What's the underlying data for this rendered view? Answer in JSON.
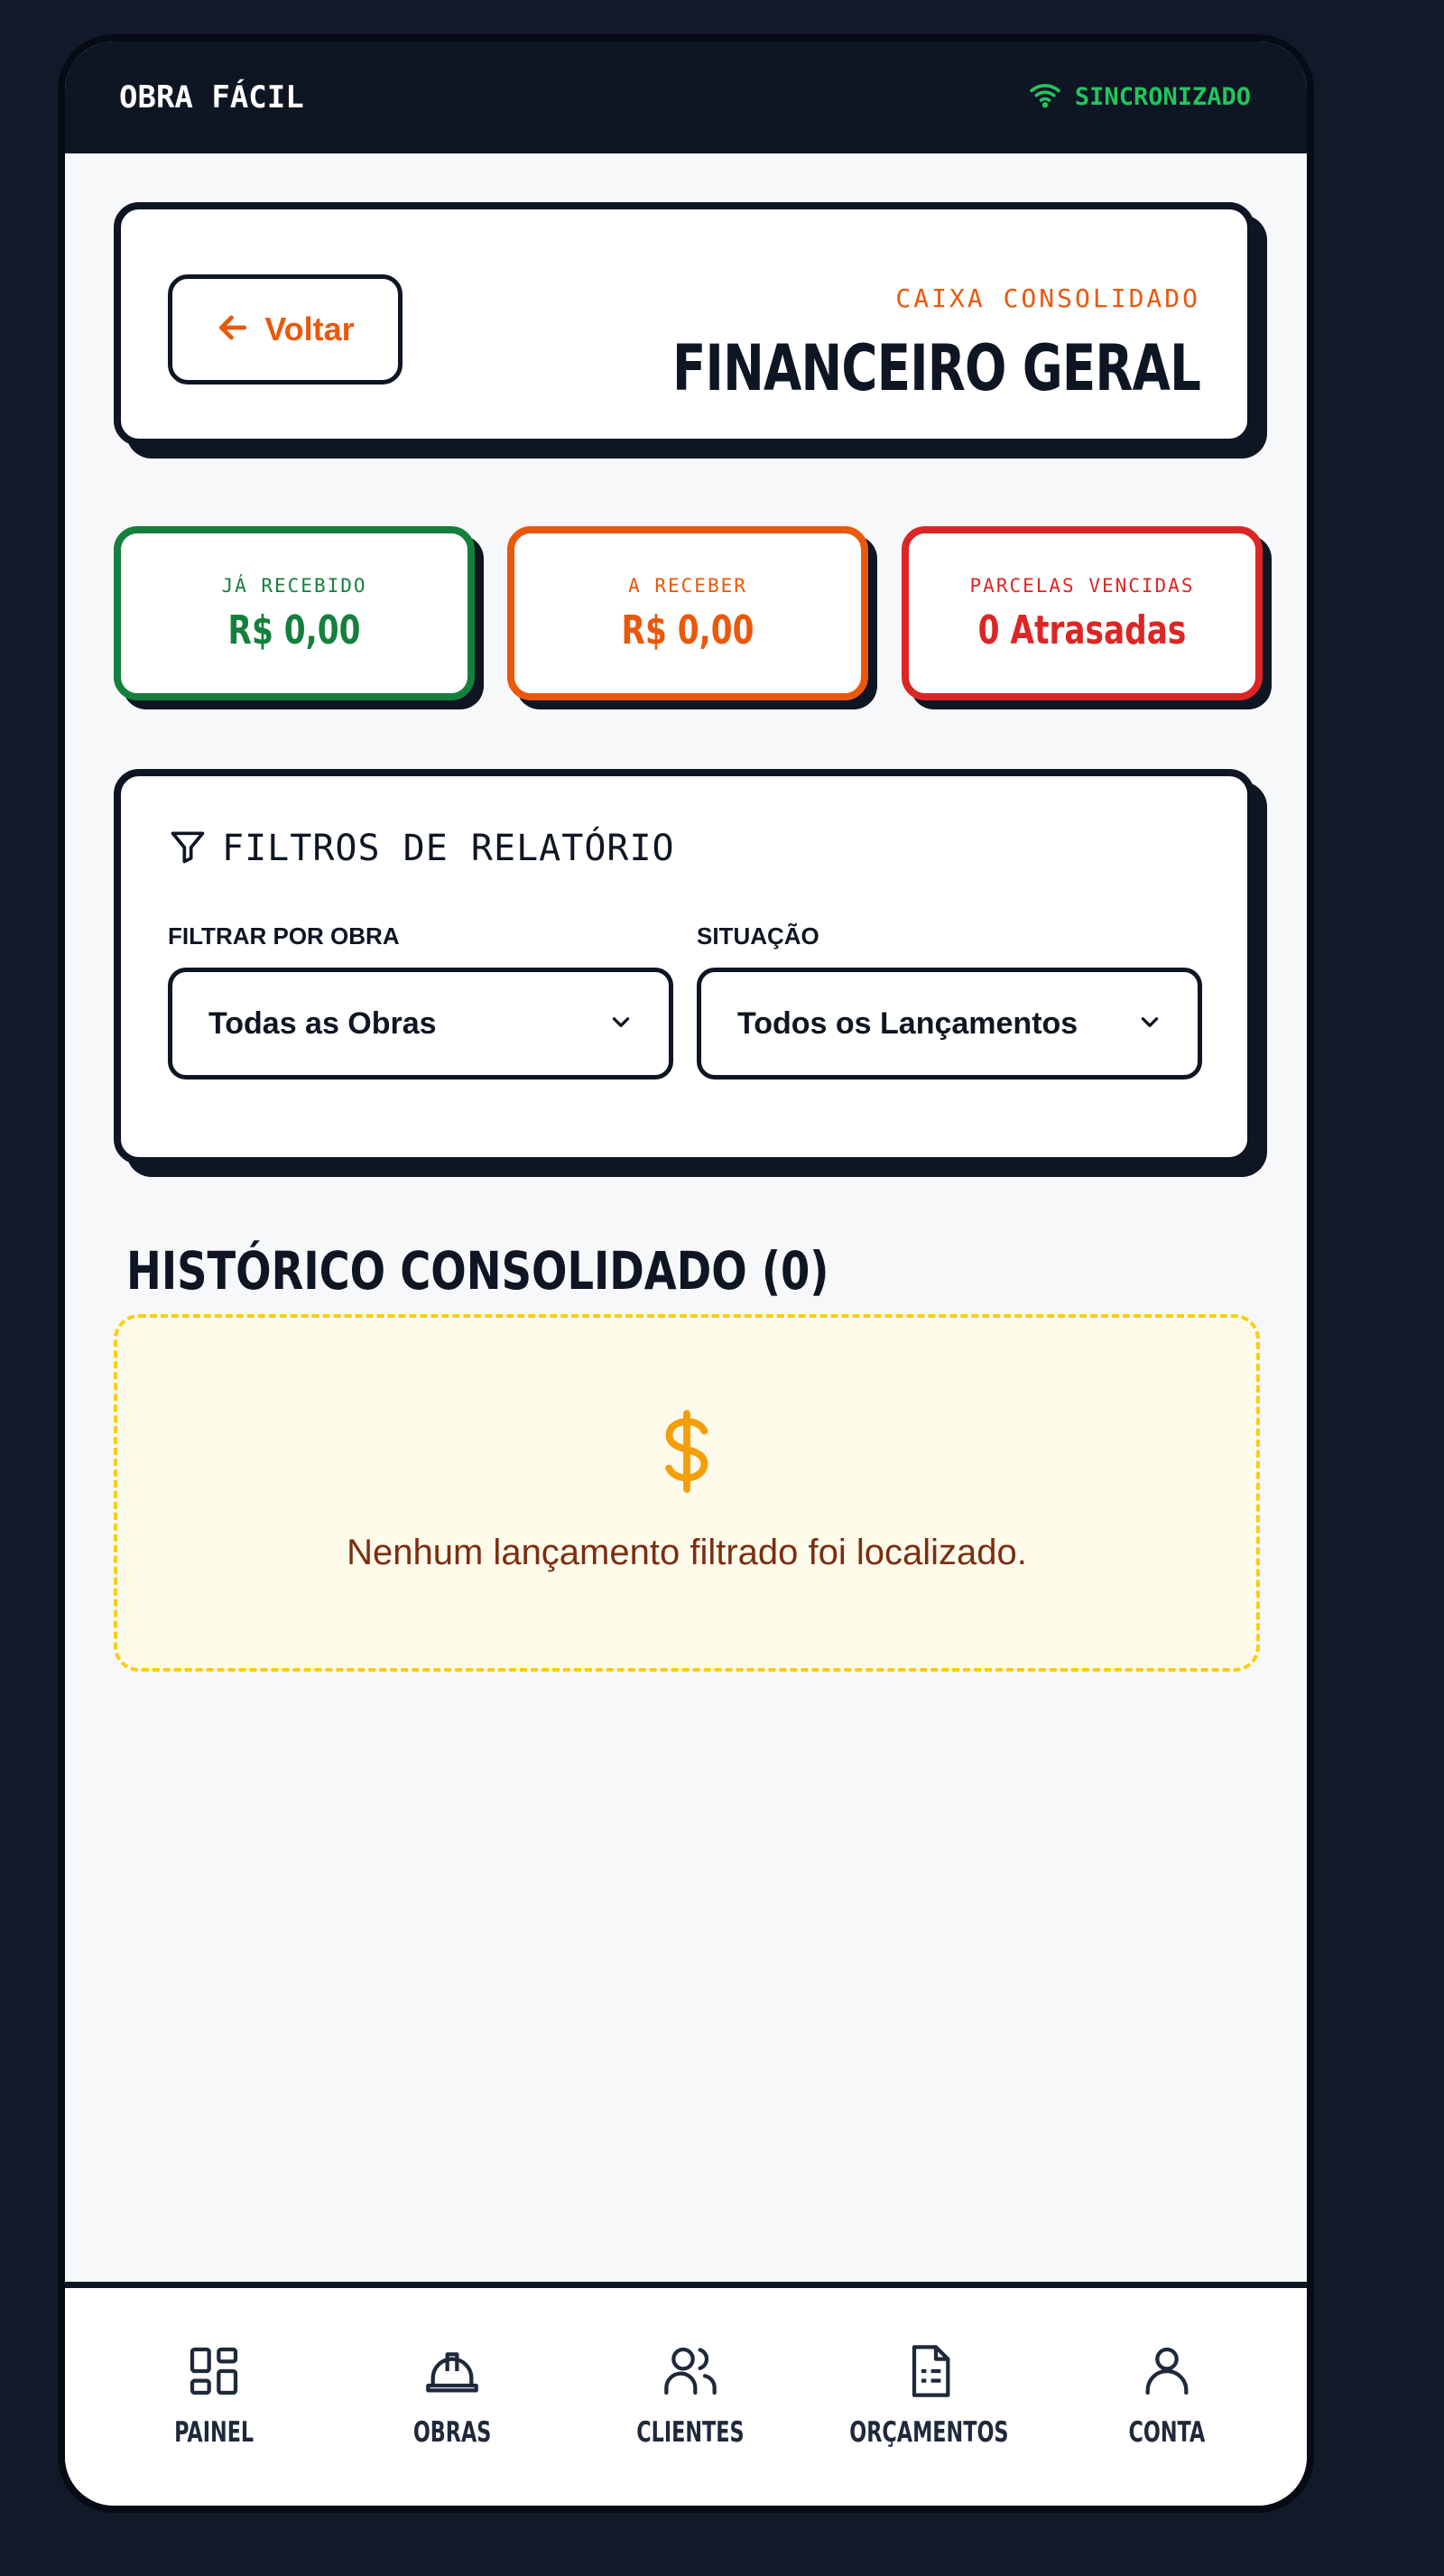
{
  "status_bar": {
    "app_name": "OBRA FÁCIL",
    "sync_label": "SINCRONIZADO",
    "sync_icon": "wifi-icon"
  },
  "header": {
    "back_label": "Voltar",
    "eyebrow": "CAIXA CONSOLIDADO",
    "title": "FINANCEIRO GERAL"
  },
  "stats": [
    {
      "label": "JÁ RECEBIDO",
      "value": "R$ 0,00",
      "color": "#15803d"
    },
    {
      "label": "A RECEBER",
      "value": "R$ 0,00",
      "color": "#ea580c"
    },
    {
      "label": "PARCELAS VENCIDAS",
      "value": "0 Atrasadas",
      "color": "#dc2626"
    }
  ],
  "filters": {
    "title": "FILTROS DE RELATÓRIO",
    "obra_label": "FILTRAR POR OBRA",
    "obra_value": "Todas as Obras",
    "situacao_label": "SITUAÇÃO",
    "situacao_value": "Todos os Lançamentos"
  },
  "history": {
    "title": "HISTÓRICO CONSOLIDADO (0)",
    "empty_icon": "dollar-icon",
    "empty_text": "Nenhum lançamento filtrado foi localizado."
  },
  "bottom_nav": [
    {
      "label": "PAINEL",
      "icon": "dashboard-icon"
    },
    {
      "label": "OBRAS",
      "icon": "hardhat-icon"
    },
    {
      "label": "CLIENTES",
      "icon": "users-icon"
    },
    {
      "label": "ORÇAMENTOS",
      "icon": "document-icon"
    },
    {
      "label": "CONTA",
      "icon": "user-icon"
    }
  ],
  "colors": {
    "accent": "#ea580c",
    "dark": "#0e1523",
    "success": "#15803d",
    "danger": "#dc2626",
    "sync": "#22c55e"
  }
}
